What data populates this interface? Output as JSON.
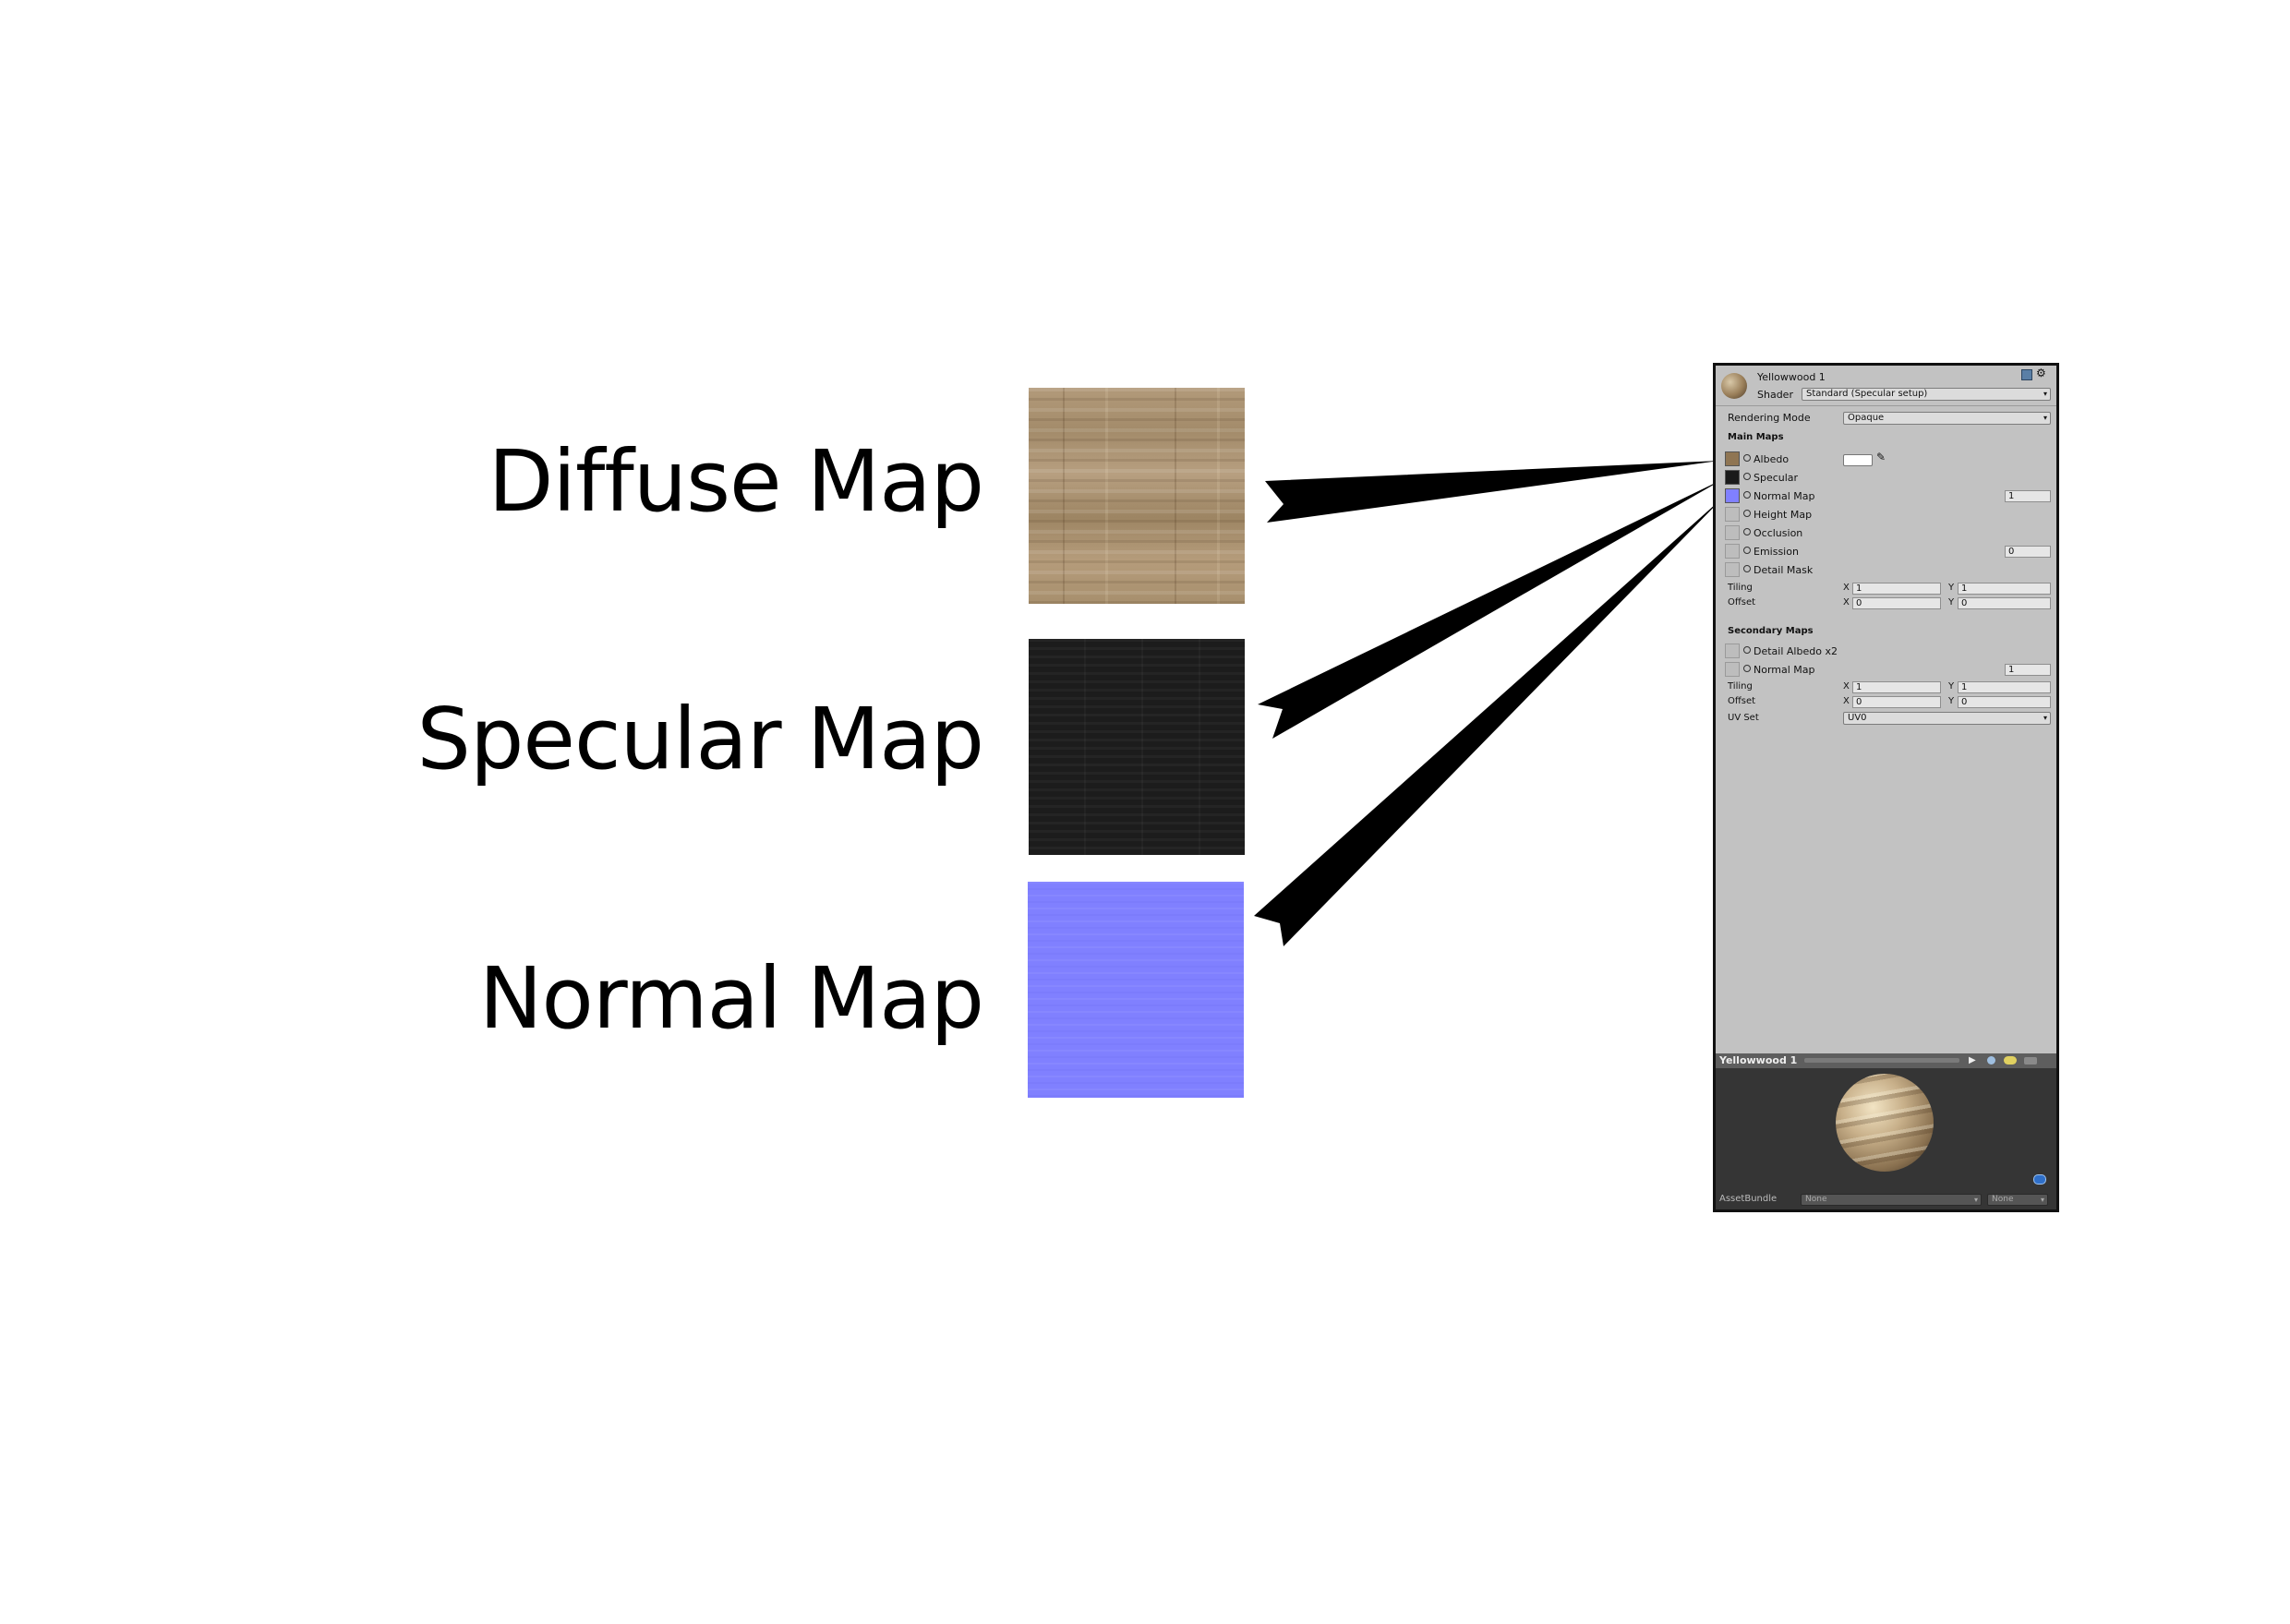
{
  "labels": {
    "diffuse": "Diffuse Map",
    "specular": "Specular Map",
    "normal": "Normal Map"
  },
  "inspector": {
    "material_name": "Yellowwood 1",
    "shader_label": "Shader",
    "shader_value": "Standard (Specular setup)",
    "rendering_mode_label": "Rendering Mode",
    "rendering_mode_value": "Opaque",
    "main_maps": {
      "heading": "Main Maps",
      "albedo": "Albedo",
      "specular": "Specular",
      "normal_map": "Normal Map",
      "normal_value": "1",
      "height_map": "Height Map",
      "occlusion": "Occlusion",
      "emission": "Emission",
      "emission_value": "0",
      "detail_mask": "Detail Mask",
      "tiling_label": "Tiling",
      "offset_label": "Offset",
      "x_label": "X",
      "y_label": "Y",
      "tiling_x": "1",
      "tiling_y": "1",
      "offset_x": "0",
      "offset_y": "0"
    },
    "secondary_maps": {
      "heading": "Secondary Maps",
      "detail_albedo": "Detail Albedo x2",
      "normal_map": "Normal Map",
      "normal_value": "1",
      "tiling_label": "Tiling",
      "offset_label": "Offset",
      "tiling_x": "1",
      "tiling_y": "1",
      "offset_x": "0",
      "offset_y": "0",
      "uv_set_label": "UV Set",
      "uv_set_value": "UV0"
    },
    "preview": {
      "title": "Yellowwood 1"
    },
    "asset_bundle": {
      "label": "AssetBundle",
      "value": "None",
      "variant": "None"
    }
  },
  "colors": {
    "panel_bg": "#c2c2c2",
    "albedo_swatch": "#8f7553",
    "specular_swatch": "#1a1a1a",
    "normal_swatch": "#8080ff",
    "preview_bg": "#353535"
  }
}
